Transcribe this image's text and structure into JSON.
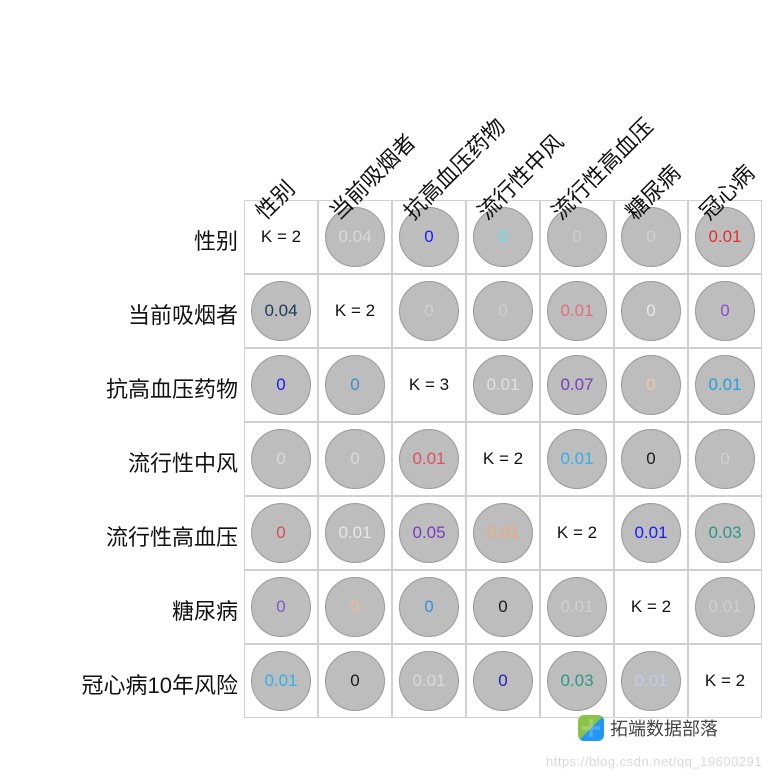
{
  "chart_data": {
    "type": "heatmap",
    "title": "",
    "row_labels": [
      "性别",
      "当前吸烟者",
      "抗高血压药物",
      "流行性中风",
      "流行性高血压",
      "糖尿病",
      "冠心病10年风险"
    ],
    "col_labels": [
      "性别",
      "当前吸烟者",
      "抗高血压药物",
      "流行性中风",
      "流行性高血压",
      "糖尿病",
      "冠心病"
    ],
    "diagonal": [
      "K = 2",
      "K = 2",
      "K = 3",
      "K = 2",
      "K = 2",
      "K = 2",
      "K = 2"
    ],
    "cells": [
      [
        {
          "v": "K = 2",
          "diag": true
        },
        {
          "v": "0.04",
          "c": "#d9d9d9"
        },
        {
          "v": "0",
          "c": "#1a1aff"
        },
        {
          "v": "0",
          "c": "#66e0e0"
        },
        {
          "v": "0",
          "c": "#cfcfcf"
        },
        {
          "v": "0",
          "c": "#cfcfcf"
        },
        {
          "v": "0.01",
          "c": "#e03030"
        }
      ],
      [
        {
          "v": "0.04",
          "c": "#1a3a5a"
        },
        {
          "v": "K = 2",
          "diag": true
        },
        {
          "v": "0",
          "c": "#cfcfcf"
        },
        {
          "v": "0",
          "c": "#cfcfcf"
        },
        {
          "v": "0.01",
          "c": "#e07080"
        },
        {
          "v": "0",
          "c": "#e8e8e8"
        },
        {
          "v": "0",
          "c": "#8a4dd0"
        }
      ],
      [
        {
          "v": "0",
          "c": "#1a1aff"
        },
        {
          "v": "0",
          "c": "#3a8ad0"
        },
        {
          "v": "K = 3",
          "diag": true
        },
        {
          "v": "0.01",
          "c": "#e0e0e0"
        },
        {
          "v": "0.07",
          "c": "#7a3dc0"
        },
        {
          "v": "0",
          "c": "#f0c8a0"
        },
        {
          "v": "0.01",
          "c": "#20a0e0"
        }
      ],
      [
        {
          "v": "0",
          "c": "#d9d9d9"
        },
        {
          "v": "0",
          "c": "#d9d9d9"
        },
        {
          "v": "0.01",
          "c": "#e05060"
        },
        {
          "v": "K = 2",
          "diag": true
        },
        {
          "v": "0.01",
          "c": "#30b0e8"
        },
        {
          "v": "0",
          "c": "#1a1a1a"
        },
        {
          "v": "0",
          "c": "#d0d0d0"
        }
      ],
      [
        {
          "v": "0",
          "c": "#d05060"
        },
        {
          "v": "0.01",
          "c": "#e8e8e8"
        },
        {
          "v": "0.05",
          "c": "#7a3dc0"
        },
        {
          "v": "0.01",
          "c": "#f0a878"
        },
        {
          "v": "K = 2",
          "diag": true
        },
        {
          "v": "0.01",
          "c": "#1a1aff"
        },
        {
          "v": "0.03",
          "c": "#2a9888"
        }
      ],
      [
        {
          "v": "0",
          "c": "#7a5ac0"
        },
        {
          "v": "0",
          "c": "#f0b890"
        },
        {
          "v": "0",
          "c": "#3090d8"
        },
        {
          "v": "0",
          "c": "#1a1a1a"
        },
        {
          "v": "0.01",
          "c": "#d0d0d0"
        },
        {
          "v": "K = 2",
          "diag": true
        },
        {
          "v": "0.01",
          "c": "#d0d0d0"
        }
      ],
      [
        {
          "v": "0.01",
          "c": "#30b0e8"
        },
        {
          "v": "0",
          "c": "#1a1a1a"
        },
        {
          "v": "0.01",
          "c": "#d9d9d9"
        },
        {
          "v": "0",
          "c": "#2020c0"
        },
        {
          "v": "0.03",
          "c": "#2a9888"
        },
        {
          "v": "0.01",
          "c": "#c8c8e8"
        },
        {
          "v": "K = 2",
          "diag": true
        }
      ]
    ]
  },
  "brand": "拓端数据部落",
  "watermark": "https://blog.csdn.net/qq_19600291"
}
